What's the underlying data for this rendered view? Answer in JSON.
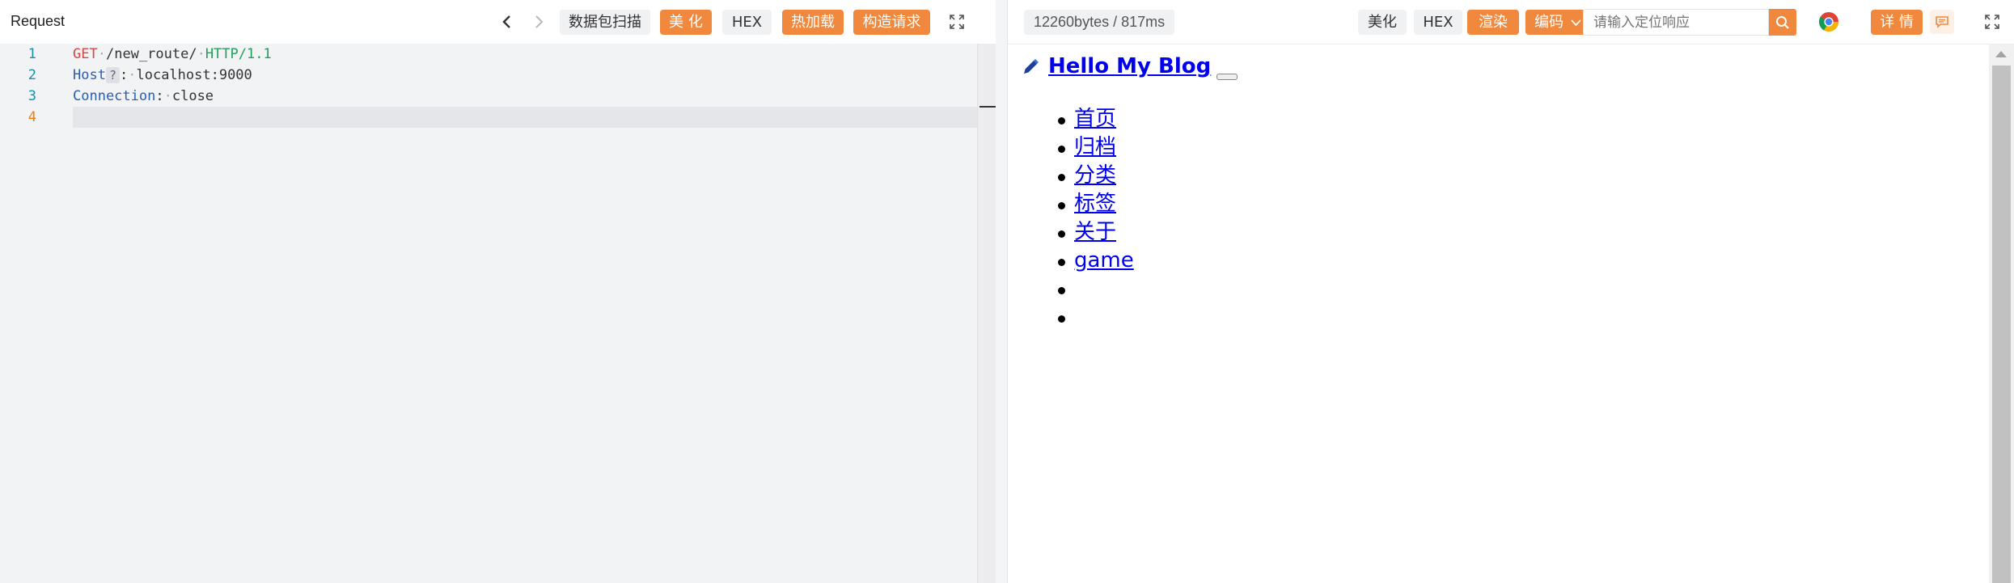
{
  "request": {
    "title": "Request",
    "buttons": {
      "scan": "数据包扫描",
      "beautify": "美 化",
      "hex": "HEX",
      "hot_load": "热加载",
      "construct": "构造请求"
    },
    "lines": [
      {
        "num": "1",
        "method": "GET",
        "path": "/new_route/",
        "protocol": "HTTP/1.1"
      },
      {
        "num": "2",
        "key": "Host",
        "hint": "?",
        "value": "localhost:9000"
      },
      {
        "num": "3",
        "key": "Connection",
        "value": "close"
      },
      {
        "num": "4"
      }
    ]
  },
  "response": {
    "stats": "12260bytes / 817ms",
    "buttons": {
      "beautify": "美化",
      "hex": "HEX",
      "render": "渲染",
      "encoding": "编码",
      "details": "详 情"
    },
    "search_placeholder": "请输入定位响应",
    "page": {
      "title": "Hello My Blog",
      "nav": [
        "首页",
        "归档",
        "分类",
        "标签",
        "关于",
        "game",
        "",
        ""
      ]
    }
  },
  "colors": {
    "accent": "#f0883e",
    "link": "#0000ee"
  },
  "icons": [
    "chevron-left-icon",
    "chevron-right-icon",
    "expand-icon",
    "search-icon",
    "chrome-icon",
    "comment-icon",
    "pencil-icon",
    "chevron-down-icon"
  ]
}
